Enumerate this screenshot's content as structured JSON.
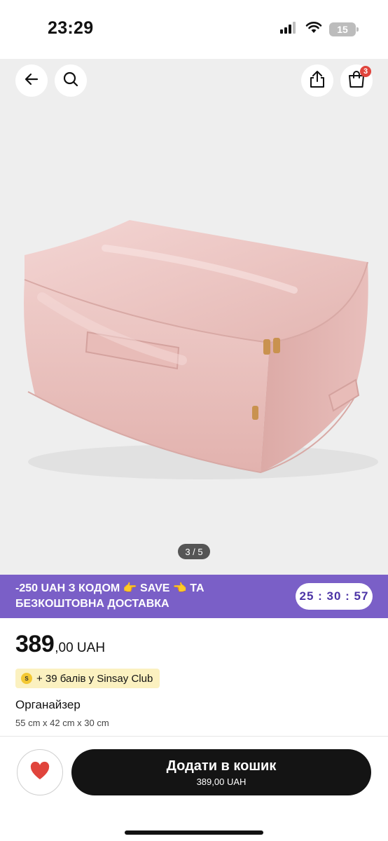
{
  "status_bar": {
    "time": "23:29",
    "battery": "15",
    "icons": [
      "cellular-signal-icon",
      "wifi-icon",
      "battery-icon"
    ]
  },
  "header": {
    "cart_badge": "3",
    "icons": [
      "back-arrow-icon",
      "search-icon",
      "share-icon",
      "shopping-bag-icon"
    ]
  },
  "gallery": {
    "page_indicator": "3 / 5",
    "image": "pink-storage-organizer-bag"
  },
  "promo": {
    "text": "-250 UAH З КОДОМ 👉 SAVE 👈 ТА БЕЗКОШТОВНА ДОСТАВКА",
    "countdown": "25 : 30 : 57",
    "background_color": "#7a5fc7"
  },
  "product": {
    "price_main": "389",
    "price_rest": ",00 UAH",
    "club_text": "+ 39 балів у Sinsay Club",
    "club_icon_text": "S",
    "name": "Органайзер",
    "size": "55 cm x 42 cm x 30 cm"
  },
  "bottom_bar": {
    "add_to_cart_label": "Додати в кошик",
    "add_to_cart_price": "389,00 UAH",
    "favorite_icon": "heart-icon",
    "heart_color": "#e0443c"
  }
}
